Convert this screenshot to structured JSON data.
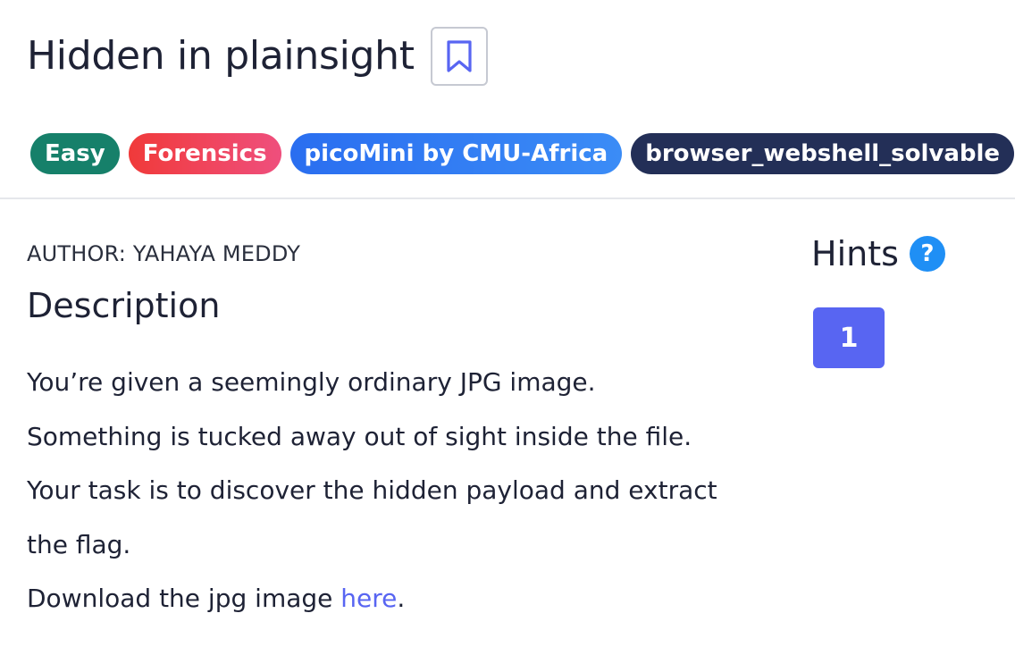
{
  "challenge": {
    "title": "Hidden in plainsight",
    "bookmark_icon": "bookmark-icon"
  },
  "tags": [
    {
      "label": "Easy",
      "color": "#16806a"
    },
    {
      "label": "Forensics",
      "color": "#f03a3a"
    },
    {
      "label": "picoMini by CMU-Africa",
      "color": "#2a6ef0"
    },
    {
      "label": "browser_webshell_solvable",
      "color": "#232f57"
    }
  ],
  "author": "AUTHOR: YAHAYA MEDDY",
  "description": {
    "heading": "Description",
    "line1": "You’re given a seemingly ordinary JPG image.",
    "line2": "Something is tucked away out of sight inside the file.",
    "line3": "Your task is to discover the hidden payload and extract the flag.",
    "download_prefix": "Download the jpg image ",
    "download_link": "here",
    "download_suffix": "."
  },
  "hints": {
    "label": "Hints",
    "help_icon_glyph": "?",
    "items": [
      "1"
    ]
  },
  "colors": {
    "accent": "#5865f2",
    "help_icon": "#1f8ff5"
  }
}
